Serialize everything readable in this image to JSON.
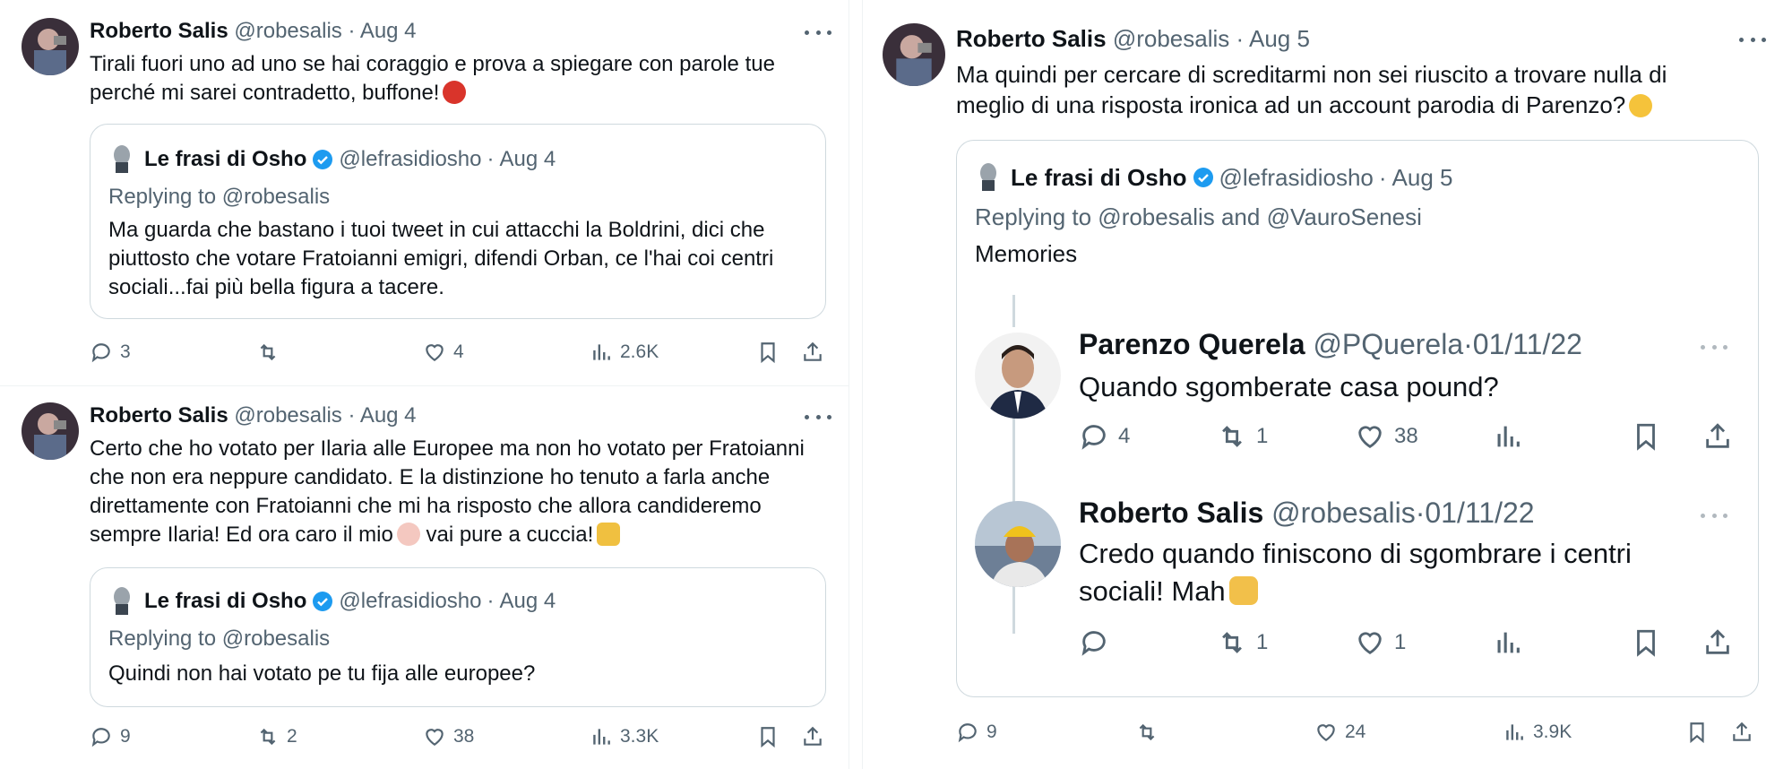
{
  "left": {
    "tweets": [
      {
        "name": "Roberto Salis",
        "handle": "@robesalis",
        "dot": "·",
        "date": "Aug 4",
        "text_line1": "Tirali fuori uno ad uno se hai coraggio e prova a spiegare con parole tue",
        "text_line2": "perché mi sarei contradetto, buffone!",
        "emoji": "swearing-face",
        "quote": {
          "name": "Le frasi di Osho",
          "handle": "@lefrasidiosho",
          "dot": "·",
          "date": "Aug 4",
          "replying": "Replying to @robesalis",
          "text": "Ma guarda che bastano i tuoi tweet in cui attacchi la Boldrini, dici che piuttosto che votare Fratoianni emigri, difendi Orban, ce l'hai coi centri sociali...fai più bella figura a tacere."
        },
        "stats": {
          "replies": "3",
          "retweets": "",
          "likes": "4",
          "views": "2.6K"
        }
      },
      {
        "name": "Roberto Salis",
        "handle": "@robesalis",
        "dot": "·",
        "date": "Aug 4",
        "text_line1": "Certo che ho votato per Ilaria alle Europee ma non ho votato per Fratoianni",
        "text_line2": "che non era neppure candidato. E la distinzione ho tenuto a farla anche",
        "text_line3": "direttamente con Fratoianni che mi ha risposto che allora candideremo",
        "text_line4a": "sempre Ilaria! Ed ora caro il mio",
        "text_line4b": "vai pure a cuccia!",
        "quote": {
          "name": "Le frasi di Osho",
          "handle": "@lefrasidiosho",
          "dot": "·",
          "date": "Aug 4",
          "replying": "Replying to @robesalis",
          "text": "Quindi non hai votato pe tu fija alle europee?"
        },
        "stats": {
          "replies": "9",
          "retweets": "2",
          "likes": "38",
          "views": "3.3K"
        }
      }
    ]
  },
  "right": {
    "tweet": {
      "name": "Roberto Salis",
      "handle": "@robesalis",
      "dot": "·",
      "date": "Aug 5",
      "text_line1": "Ma quindi per cercare di screditarmi non sei riuscito a trovare nulla di",
      "text_line2": "meglio di una risposta ironica ad un account parodia di Parenzo?",
      "quote": {
        "name": "Le frasi di Osho",
        "handle": "@lefrasidiosho",
        "dot": "·",
        "date": "Aug 5",
        "replying": "Replying to @robesalis and @VauroSenesi",
        "text": "Memories",
        "nested": [
          {
            "name": "Parenzo Querela",
            "handle": "@PQuerela",
            "dot": "·",
            "date": "01/11/22",
            "text": "Quando sgomberate casa pound?",
            "stats": {
              "replies": "4",
              "retweets": "1",
              "likes": "38"
            }
          },
          {
            "name": "Roberto Salis",
            "handle": "@robesalis",
            "dot": "·",
            "date": "01/11/22",
            "text_line1": "Credo quando finiscono di sgombrare i centri",
            "text_line2": "sociali! Mah",
            "stats": {
              "replies": "",
              "retweets": "1",
              "likes": "1"
            }
          }
        ]
      },
      "stats": {
        "replies": "9",
        "retweets": "",
        "likes": "24",
        "views": "3.9K"
      }
    }
  },
  "colors": {
    "text": "#0f1419",
    "muted": "#536471",
    "border": "#cfd9de",
    "verified": "#1d9bf0"
  }
}
